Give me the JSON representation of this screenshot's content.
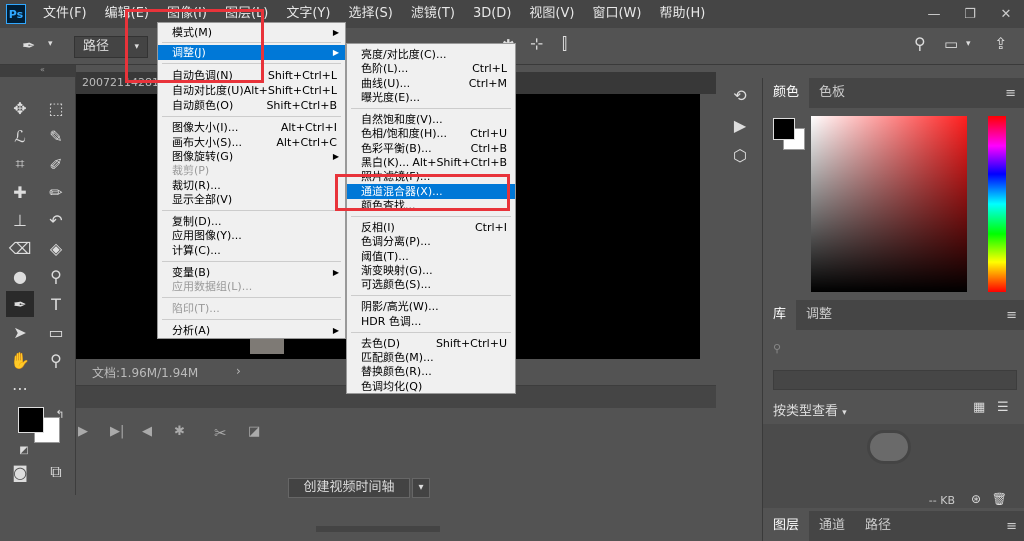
{
  "app": {
    "logo": "Ps"
  },
  "menubar": [
    "文件(F)",
    "编辑(E)",
    "图像(I)",
    "图层(L)",
    "文字(Y)",
    "选择(S)",
    "滤镜(T)",
    "3D(D)",
    "视图(V)",
    "窗口(W)",
    "帮助(H)"
  ],
  "window_controls": {
    "minimize": "—",
    "restore": "❐",
    "close": "✕"
  },
  "options": {
    "mode": "路径"
  },
  "doc_tab": "20072114281…",
  "status": "文档:1.96M/1.94M",
  "timeline": {
    "create_button": "创建视频时间轴"
  },
  "image_menu": {
    "items": [
      {
        "label": "模式(M)",
        "shortcut": "",
        "submenu": true
      },
      {
        "label": "调整(J)",
        "shortcut": "",
        "submenu": true,
        "highlighted": true
      },
      {
        "label": "自动色调(N)",
        "shortcut": "Shift+Ctrl+L"
      },
      {
        "label": "自动对比度(U)",
        "shortcut": "Alt+Shift+Ctrl+L"
      },
      {
        "label": "自动颜色(O)",
        "shortcut": "Shift+Ctrl+B"
      },
      {
        "label": "图像大小(I)...",
        "shortcut": "Alt+Ctrl+I"
      },
      {
        "label": "画布大小(S)...",
        "shortcut": "Alt+Ctrl+C"
      },
      {
        "label": "图像旋转(G)",
        "shortcut": "",
        "submenu": true
      },
      {
        "label": "裁剪(P)",
        "shortcut": "",
        "disabled": true
      },
      {
        "label": "裁切(R)...",
        "shortcut": ""
      },
      {
        "label": "显示全部(V)",
        "shortcut": ""
      },
      {
        "label": "复制(D)...",
        "shortcut": ""
      },
      {
        "label": "应用图像(Y)...",
        "shortcut": ""
      },
      {
        "label": "计算(C)...",
        "shortcut": ""
      },
      {
        "label": "变量(B)",
        "shortcut": "",
        "submenu": true
      },
      {
        "label": "应用数据组(L)...",
        "shortcut": "",
        "disabled": true
      },
      {
        "label": "陷印(T)...",
        "shortcut": "",
        "disabled": true
      },
      {
        "label": "分析(A)",
        "shortcut": "",
        "submenu": true
      }
    ]
  },
  "adjust_menu": {
    "items": [
      {
        "label": "亮度/对比度(C)...",
        "shortcut": ""
      },
      {
        "label": "色阶(L)...",
        "shortcut": "Ctrl+L"
      },
      {
        "label": "曲线(U)...",
        "shortcut": "Ctrl+M"
      },
      {
        "label": "曝光度(E)...",
        "shortcut": ""
      },
      {
        "label": "自然饱和度(V)...",
        "shortcut": ""
      },
      {
        "label": "色相/饱和度(H)...",
        "shortcut": "Ctrl+U"
      },
      {
        "label": "色彩平衡(B)...",
        "shortcut": "Ctrl+B"
      },
      {
        "label": "黑白(K)...",
        "shortcut": "Alt+Shift+Ctrl+B"
      },
      {
        "label": "照片滤镜(F)...",
        "shortcut": ""
      },
      {
        "label": "通道混合器(X)...",
        "shortcut": "",
        "highlighted": true
      },
      {
        "label": "颜色查找...",
        "shortcut": ""
      },
      {
        "label": "反相(I)",
        "shortcut": "Ctrl+I"
      },
      {
        "label": "色调分离(P)...",
        "shortcut": ""
      },
      {
        "label": "阈值(T)...",
        "shortcut": ""
      },
      {
        "label": "渐变映射(G)...",
        "shortcut": ""
      },
      {
        "label": "可选颜色(S)...",
        "shortcut": ""
      },
      {
        "label": "阴影/高光(W)...",
        "shortcut": ""
      },
      {
        "label": "HDR 色调...",
        "shortcut": ""
      },
      {
        "label": "去色(D)",
        "shortcut": "Shift+Ctrl+U"
      },
      {
        "label": "匹配颜色(M)...",
        "shortcut": ""
      },
      {
        "label": "替换颜色(R)...",
        "shortcut": ""
      },
      {
        "label": "色调均化(Q)",
        "shortcut": ""
      }
    ]
  },
  "panels": {
    "color_tabs": [
      "颜色",
      "色板"
    ],
    "library_tabs": [
      "库",
      "调整"
    ],
    "library_view": "按类型查看",
    "library_size": "-- KB",
    "bottom_tabs": [
      "图层",
      "通道",
      "路径"
    ]
  },
  "colors": {
    "highlight": "#0078d7",
    "annotation": "#e8333a",
    "foreground": "#000000",
    "background": "#ffffff"
  }
}
